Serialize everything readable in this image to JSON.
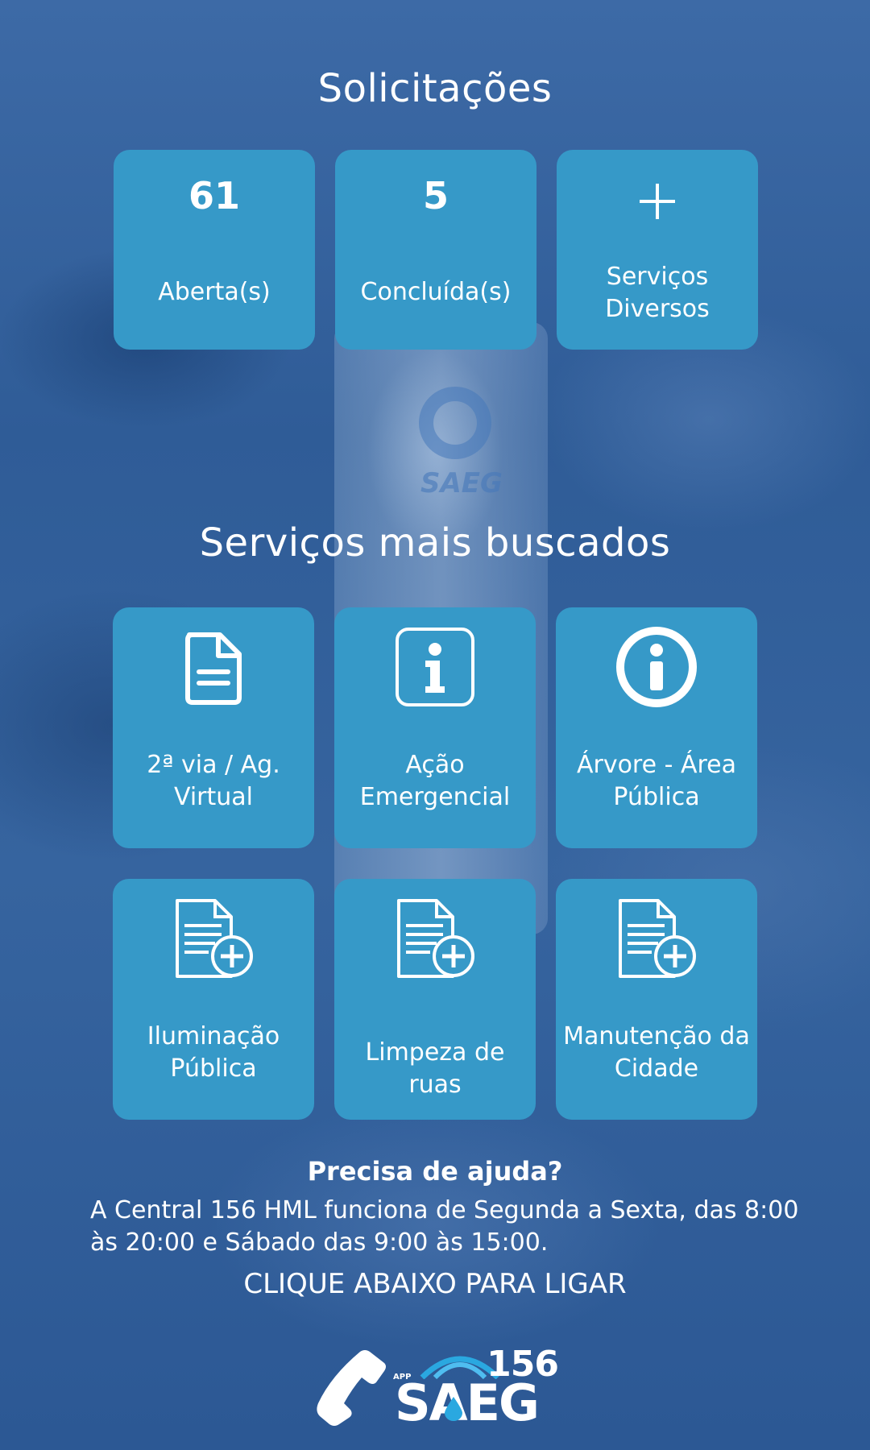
{
  "solicitacoes": {
    "title": "Solicitações",
    "cards": [
      {
        "count": "61",
        "label": "Aberta(s)"
      },
      {
        "count": "5",
        "label": "Concluída(s)"
      },
      {
        "icon": "plus-icon",
        "label": "Serviços Diversos"
      }
    ]
  },
  "servicos": {
    "title": "Serviços mais buscados",
    "cards": [
      {
        "icon": "document-icon",
        "label": "2ª via / Ag. Virtual"
      },
      {
        "icon": "info-square-icon",
        "label": "Ação Emergencial"
      },
      {
        "icon": "info-circle-icon",
        "label": "Árvore - Área Pública"
      },
      {
        "icon": "document-add-icon",
        "label": "Iluminação Pública"
      },
      {
        "icon": "document-add-icon",
        "label": "Limpeza de ruas"
      },
      {
        "icon": "document-add-icon",
        "label": "Manutenção da Cidade"
      }
    ]
  },
  "help": {
    "title": "Precisa de ajuda?",
    "text": "A Central 156 HML funciona de Segunda a Sexta, das 8:00 às 20:00 e Sábado das 9:00 às 15:00.",
    "cta": "CLIQUE ABAIXO PARA LIGAR"
  },
  "logo": {
    "app": "APP",
    "number": "156",
    "name": "SAEG"
  },
  "colors": {
    "card": "#3699c8",
    "background": "#2f5c97"
  }
}
